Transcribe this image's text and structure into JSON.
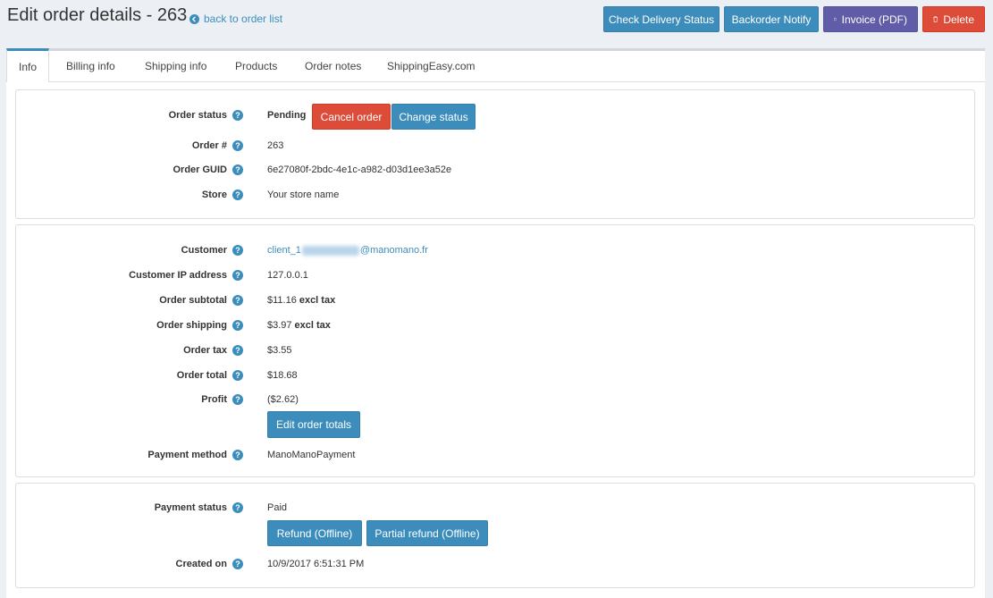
{
  "header": {
    "title": "Edit order details - 263",
    "back_link": "back to order list",
    "buttons": {
      "check_delivery": "Check Delivery Status",
      "backorder": "Backorder Notify",
      "invoice": "Invoice (PDF)",
      "delete": "Delete"
    }
  },
  "tabs": [
    "Info",
    "Billing info",
    "Shipping info",
    "Products",
    "Order notes",
    "ShippingEasy.com"
  ],
  "order_panel": {
    "status_label": "Order status",
    "status_value": "Pending",
    "cancel_button": "Cancel order",
    "change_status_button": "Change status",
    "number_label": "Order #",
    "number_value": "263",
    "guid_label": "Order GUID",
    "guid_value": "6e27080f-2bdc-4e1c-a982-d03d1ee3a52e",
    "store_label": "Store",
    "store_value": "Your store name"
  },
  "customer_panel": {
    "customer_label": "Customer",
    "customer_prefix": "client_1",
    "customer_suffix": "@manomano.fr",
    "ip_label": "Customer IP address",
    "ip_value": "127.0.0.1",
    "subtotal_label": "Order subtotal",
    "subtotal_value": "$11.16",
    "subtotal_suffix": "excl tax",
    "shipping_label": "Order shipping",
    "shipping_value": "$3.97",
    "shipping_suffix": "excl tax",
    "tax_label": "Order tax",
    "tax_value": "$3.55",
    "total_label": "Order total",
    "total_value": "$18.68",
    "profit_label": "Profit",
    "profit_value": "($2.62)",
    "edit_totals_button": "Edit order totals",
    "payment_method_label": "Payment method",
    "payment_method_value": "ManoManoPayment"
  },
  "payment_panel": {
    "status_label": "Payment status",
    "status_value": "Paid",
    "refund_button": "Refund (Offline)",
    "partial_refund_button": "Partial refund (Offline)",
    "created_label": "Created on",
    "created_value": "10/9/2017 6:51:31 PM"
  },
  "colors": {
    "primary": "#3c8dbc",
    "danger": "#dd4b39",
    "purple": "#605ca8",
    "background": "#ecf0f5"
  }
}
